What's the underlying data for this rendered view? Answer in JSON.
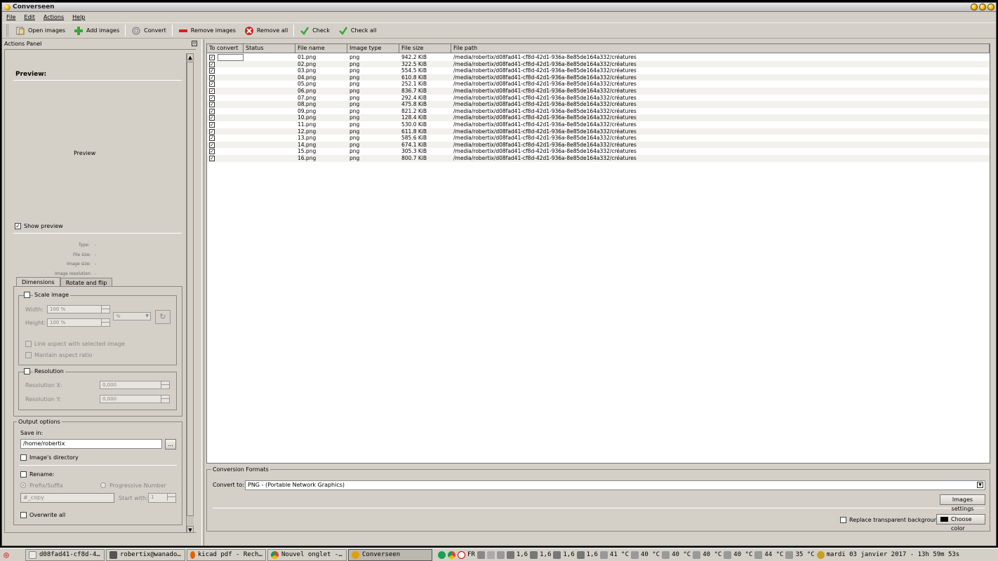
{
  "window": {
    "title": "Converseen"
  },
  "menu": [
    "File",
    "Edit",
    "Actions",
    "Help"
  ],
  "toolbar": {
    "open_images": "Open images",
    "add_images": "Add images",
    "convert": "Convert",
    "remove_images": "Remove images",
    "remove_all": "Remove all",
    "check": "Check",
    "check_all": "Check all"
  },
  "actions_panel": {
    "title": "Actions Panel",
    "preview_heading": "Preview:",
    "preview_placeholder": "Preview",
    "show_preview": "Show preview",
    "show_preview_checked": true,
    "info": {
      "type_label": "Type:",
      "type_value": "-",
      "file_size_label": "File size:",
      "file_size_value": "-",
      "image_size_label": "Image size:",
      "image_size_value": "-",
      "image_resolution_label": "Image resolution:",
      "image_resolution_value": "-"
    },
    "tabs": [
      "Dimensions",
      "Rotate and flip"
    ],
    "scale_image": "Scale image",
    "width_label": "Width:",
    "width_value": "100 %",
    "height_label": "Height:",
    "height_value": "100 %",
    "unit_value": "%",
    "link_aspect": "Link aspect with selected image",
    "maintain_aspect": "Mantain aspect ratio",
    "resolution": "Resolution",
    "resolution_x_label": "Resolution X:",
    "resolution_x_value": "0,000",
    "resolution_y_label": "Resolution Y:",
    "resolution_y_value": "0,000",
    "output_options": "Output options",
    "save_in_label": "Save in:",
    "save_in_value": "/home/robertix",
    "browse_label": "...",
    "images_directory": "Image's directory",
    "rename": "Rename:",
    "prefix_suffix": "Prefix/Suffix",
    "progressive_number": "Progressive Number",
    "prefix_value": "#_copy",
    "start_with_label": "Start with:",
    "start_with_value": "1",
    "overwrite_all": "Overwrite all"
  },
  "table": {
    "columns": [
      "To convert",
      "Status",
      "File name",
      "Image type",
      "File size",
      "File path"
    ],
    "rows": [
      {
        "name": "01.png",
        "type": "png",
        "size": "942.2 KiB",
        "path": "/media/robertix/d08fad41-cf8d-42d1-936a-8e85de164a332/créatures"
      },
      {
        "name": "02.png",
        "type": "png",
        "size": "322.5 KiB",
        "path": "/media/robertix/d08fad41-cf8d-42d1-936a-8e85de164a332/créatures"
      },
      {
        "name": "03.png",
        "type": "png",
        "size": "554.5 KiB",
        "path": "/media/robertix/d08fad41-cf8d-42d1-936a-8e85de164a332/créatures"
      },
      {
        "name": "04.png",
        "type": "png",
        "size": "610.8 KiB",
        "path": "/media/robertix/d08fad41-cf8d-42d1-936a-8e85de164a332/créatures"
      },
      {
        "name": "05.png",
        "type": "png",
        "size": "252.1 KiB",
        "path": "/media/robertix/d08fad41-cf8d-42d1-936a-8e85de164a332/créatures"
      },
      {
        "name": "06.png",
        "type": "png",
        "size": "836.7 KiB",
        "path": "/media/robertix/d08fad41-cf8d-42d1-936a-8e85de164a332/créatures"
      },
      {
        "name": "07.png",
        "type": "png",
        "size": "292.4 KiB",
        "path": "/media/robertix/d08fad41-cf8d-42d1-936a-8e85de164a332/créatures"
      },
      {
        "name": "08.png",
        "type": "png",
        "size": "475.8 KiB",
        "path": "/media/robertix/d08fad41-cf8d-42d1-936a-8e85de164a332/créatures"
      },
      {
        "name": "09.png",
        "type": "png",
        "size": "821.2 KiB",
        "path": "/media/robertix/d08fad41-cf8d-42d1-936a-8e85de164a332/créatures"
      },
      {
        "name": "10.png",
        "type": "png",
        "size": "128.4 KiB",
        "path": "/media/robertix/d08fad41-cf8d-42d1-936a-8e85de164a332/créatures"
      },
      {
        "name": "11.png",
        "type": "png",
        "size": "530.0 KiB",
        "path": "/media/robertix/d08fad41-cf8d-42d1-936a-8e85de164a332/créatures"
      },
      {
        "name": "12.png",
        "type": "png",
        "size": "611.8 KiB",
        "path": "/media/robertix/d08fad41-cf8d-42d1-936a-8e85de164a332/créatures"
      },
      {
        "name": "13.png",
        "type": "png",
        "size": "585.6 KiB",
        "path": "/media/robertix/d08fad41-cf8d-42d1-936a-8e85de164a332/créatures"
      },
      {
        "name": "14.png",
        "type": "png",
        "size": "674.1 KiB",
        "path": "/media/robertix/d08fad41-cf8d-42d1-936a-8e85de164a332/créatures"
      },
      {
        "name": "15.png",
        "type": "png",
        "size": "305.3 KiB",
        "path": "/media/robertix/d08fad41-cf8d-42d1-936a-8e85de164a332/créatures"
      },
      {
        "name": "16.png",
        "type": "png",
        "size": "800.7 KiB",
        "path": "/media/robertix/d08fad41-cf8d-42d1-936a-8e85de164a332/créatures"
      }
    ]
  },
  "conversion": {
    "legend": "Conversion Formats",
    "convert_to_label": "Convert to:",
    "format_value": "PNG - (Portable Network Graphics)",
    "images_settings": "Images settings",
    "replace_transparent": "Replace transparent background",
    "choose_color": "Choose color"
  },
  "taskbar": {
    "tasks": [
      "d08fad41-cf8d-4…",
      "robertix@wanado…",
      "kicad pdf - Rech…",
      "Nouvel onglet -…",
      "Converseen"
    ],
    "lang": "FR",
    "meters": [
      "1,6",
      "1,6",
      "1,6",
      "1,6"
    ],
    "temps": [
      "41 °C",
      "40 °C",
      "40 °C",
      "40 °C",
      "40 °C",
      "44 °C",
      "35 °C"
    ],
    "clock": "mardi 03 janvier 2017 - 13h 59m 53s"
  },
  "colors": {
    "window_bg": "#d4d0c8",
    "title_button": "#f0b000",
    "check_green": "#3aa63a",
    "remove_red": "#d42020"
  }
}
